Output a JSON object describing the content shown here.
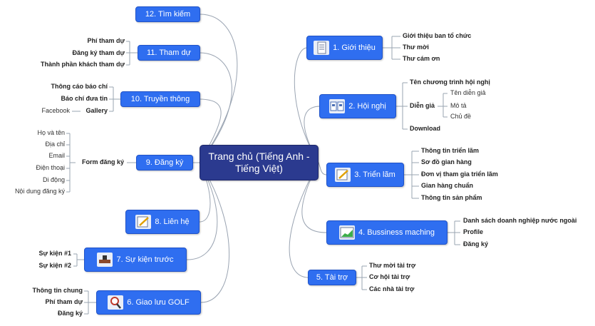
{
  "central": {
    "label": "Trang chủ (Tiếng Anh - Tiếng Việt)"
  },
  "nodes": {
    "n1": {
      "label": "1. Giới thiệu",
      "icon": "document-icon"
    },
    "n2": {
      "label": "2. Hội nghị",
      "icon": "conference-icon"
    },
    "n3": {
      "label": "3. Triển lãm",
      "icon": "pencil-icon"
    },
    "n4": {
      "label": "4. Bussiness maching",
      "icon": "chart-icon"
    },
    "n5": {
      "label": "5. Tài trợ"
    },
    "n6": {
      "label": "6. Giao lưu GOLF",
      "icon": "magnifier-icon"
    },
    "n7": {
      "label": "7. Sự kiện trước",
      "icon": "desk-icon"
    },
    "n8": {
      "label": "8. Liên hệ",
      "icon": "pencil-icon"
    },
    "n9": {
      "label": "9. Đăng ký"
    },
    "n10": {
      "label": "10. Truyền thông"
    },
    "n11": {
      "label": "11. Tham dự"
    },
    "n12": {
      "label": "12. Tìm kiếm"
    }
  },
  "leaves": {
    "gioithieu": [
      "Giới thiệu ban tổ chức",
      "Thư mời",
      "Thư cám ơn"
    ],
    "hoinghi": [
      "Tên chương trình hội nghị",
      "Diễn giả",
      "Download"
    ],
    "diengia": [
      "Tên diễn giả",
      "Mô tả",
      "Chủ đề"
    ],
    "trienlam": [
      "Thông tin triển lãm",
      "Sơ đồ gian hàng",
      "Đơn vị tham gia triển lãm",
      "Gian hàng chuẩn",
      "Thông tin sản phẩm"
    ],
    "business": [
      "Danh sách doanh nghiệp nước ngoài",
      "Profile",
      "Đăng ký"
    ],
    "taitro": [
      "Thư mời tài trợ",
      "Cơ hội tài trợ",
      "Các nhà tài trợ"
    ],
    "golf": [
      "Thông tin chung",
      "Phí tham dự",
      "Đăng ký"
    ],
    "sukien": [
      "Sự kiện #1",
      "Sự kiện #2"
    ],
    "dangky_form": "Form đăng ký",
    "dangky": [
      "Họ và tên",
      "Địa chỉ",
      "Email",
      "Điện thoại",
      "Di động",
      "Nội dung đăng ký"
    ],
    "truyenthong": [
      "Thông cáo báo chí",
      "Báo chí đưa tin",
      "Gallery"
    ],
    "gallery_sub": "Facebook",
    "thamdu": [
      "Phí tham dự",
      "Đăng ký tham dự",
      "Thành phần khách tham dự"
    ]
  },
  "colors": {
    "node": "#2f6ef0",
    "central": "#2b3a8f",
    "line": "#9aa4b2"
  }
}
